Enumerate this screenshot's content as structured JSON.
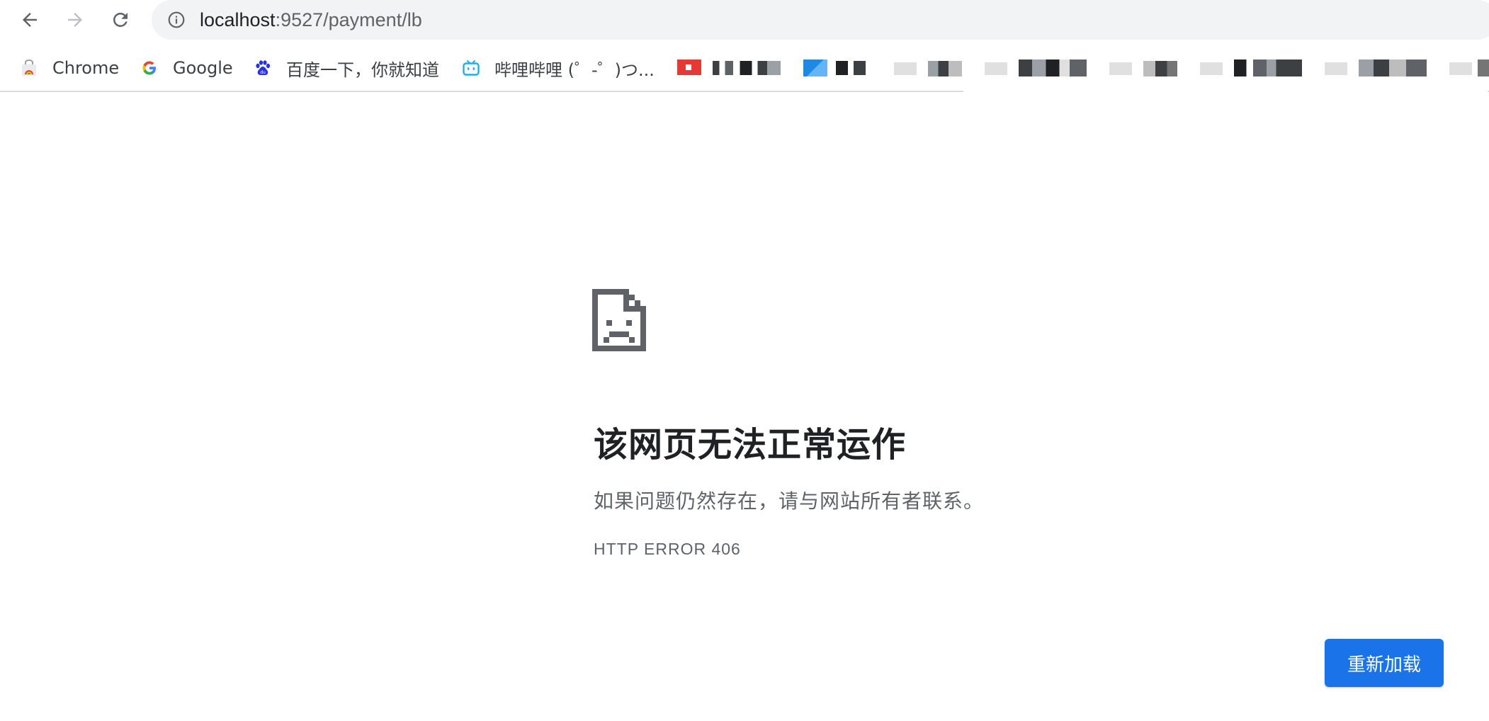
{
  "browser": {
    "url_host": "localhost",
    "url_rest": ":9527/payment/lb"
  },
  "bookmarks": [
    {
      "label": "Chrome",
      "icon": "chrome-web-store-icon"
    },
    {
      "label": "Google",
      "icon": "google-icon"
    },
    {
      "label": "百度一下，你就知道",
      "icon": "baidu-icon"
    },
    {
      "label": "哔哩哔哩 (゜-゜)つ...",
      "icon": "bilibili-icon"
    }
  ],
  "error_page": {
    "title": "该网页无法正常运作",
    "message": "如果问题仍然存在，请与网站所有者联系。",
    "code": "HTTP ERROR 406",
    "reload_label": "重新加载"
  },
  "colors": {
    "accent": "#1a73e8",
    "omnibox_bg": "#f1f3f4",
    "text_primary": "#202124",
    "text_secondary": "#5f6368"
  }
}
